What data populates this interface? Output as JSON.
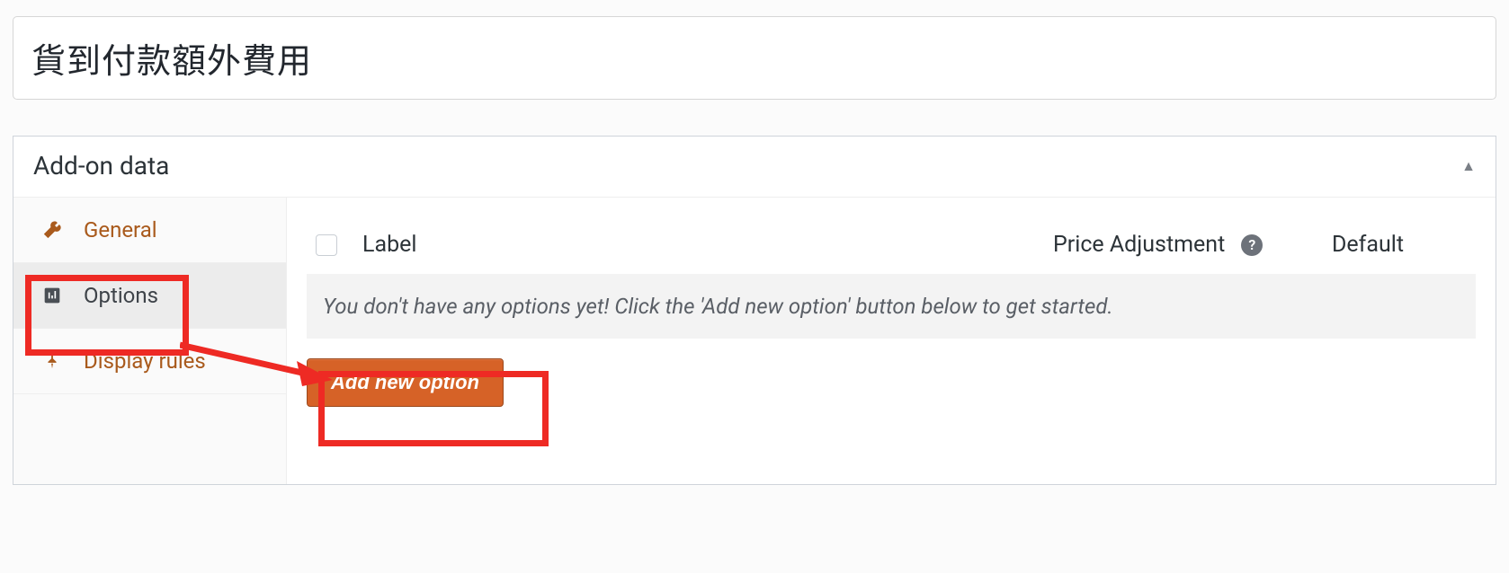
{
  "title": "貨到付款額外費用",
  "panel": {
    "header": "Add-on data"
  },
  "sidebar": {
    "tabs": [
      {
        "label": "General"
      },
      {
        "label": "Options"
      },
      {
        "label": "Display rules"
      }
    ]
  },
  "columns": {
    "label": "Label",
    "price": "Price Adjustment",
    "default": "Default",
    "help": "?"
  },
  "empty_message": "You don't have any options yet! Click the 'Add new option' button below to get started.",
  "buttons": {
    "add_new_option": "Add new option"
  }
}
